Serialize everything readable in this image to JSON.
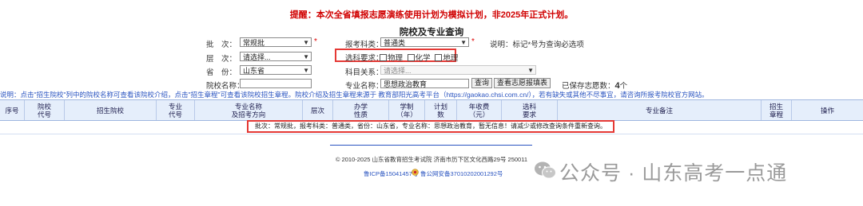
{
  "notice_top": "提醒：本次全省填报志愿演练使用计划为模拟计划，非2025年正式计划。",
  "page_title": "院校及专业查询",
  "form": {
    "batch": {
      "label": "批　次：",
      "value": "常规批"
    },
    "category": {
      "label": "报考科类：",
      "value": "普通类"
    },
    "note": "说明：标记*号为查询必选项",
    "level": {
      "label": "层　次：",
      "value": "请选择..."
    },
    "subject_req": {
      "label": "选科要求：",
      "options": [
        "物理",
        "化学",
        "地理"
      ]
    },
    "province": {
      "label": "省　份：",
      "value": "山东省"
    },
    "discipline": {
      "label": "科目关系：",
      "value": "请选择..."
    },
    "school_name": {
      "label": "院校名称：",
      "value": ""
    },
    "major_name": {
      "label": "专业名称：",
      "value": "思想政治教育"
    },
    "query_button": "查询",
    "view_saved_button": "查看志愿报填表",
    "saved_label": "已保存志愿数：",
    "saved_count": "4",
    "saved_unit": "个",
    "required_mark": "*"
  },
  "notice_line": "说明：点击\"招生院校\"列中的院校名称可查看该院校介绍，点击\"招生章程\"可查看该院校招生章程。院校介绍及招生章程来源于 教育部阳光高考平台（https://gaokao.chsi.com.cn/），若有缺失或其他不尽事宜，请咨询所报考院校官方网站。",
  "table": {
    "headers": [
      "序号",
      "院校\n代号",
      "招生院校",
      "专业\n代号",
      "专业名称\n及招考方向",
      "层次",
      "办学\n性质",
      "学制\n（年）",
      "计划\n数",
      "年收费\n（元）",
      "选科\n要求",
      "专业备注",
      "招生\n章程",
      "操作"
    ],
    "empty_message": "批次：常规批，报考科类：普通类，省份：山东省，专业名称：思想政治教育，暂无信息！请减少或修改查询条件重新查询。"
  },
  "footer": {
    "copyright": "© 2010-2025 山东省教育招生考试院 济南市历下区文化西路29号 250011",
    "icp": "鲁ICP备15041457号",
    "police": "鲁公网安备37010202001292号"
  },
  "watermark": "公众号 · 山东高考一点通",
  "colors": {
    "warning": "#d00000",
    "link": "#2a54c0",
    "highlight_box": "#e53935",
    "table_header_bg": "#e5eefb"
  }
}
